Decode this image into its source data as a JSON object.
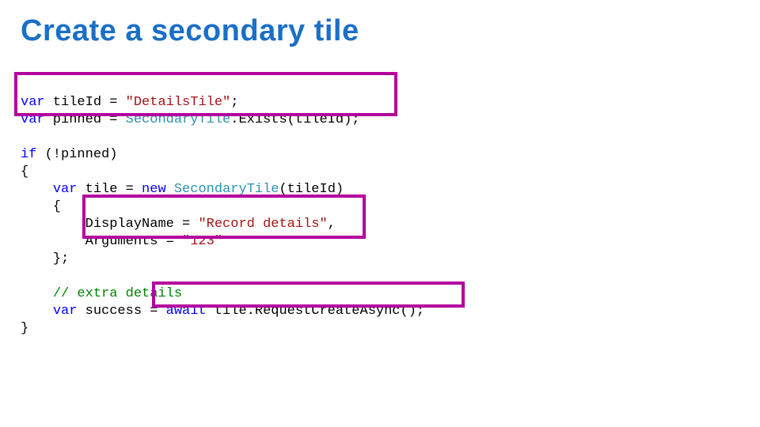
{
  "title": "Create a secondary tile",
  "code": {
    "l1": {
      "kw": "var",
      "rest": " tileId = ",
      "str": "\"DetailsTile\"",
      "semi": ";"
    },
    "l2": {
      "kw": "var",
      "rest": " pinned = ",
      "type": "SecondaryTile",
      "call": ".Exists(tileId);"
    },
    "l3": "",
    "l4": {
      "kw": "if",
      "rest": " (!pinned)"
    },
    "l5": "{",
    "l6": {
      "indent": "    ",
      "kw": "var",
      "rest1": " tile = ",
      "kw2": "new",
      "sp": " ",
      "type": "SecondaryTile",
      "rest2": "(tileId)"
    },
    "l7": "    {",
    "l8": {
      "indent": "        ",
      "name": "DisplayName = ",
      "str": "\"Record details\"",
      "comma": ","
    },
    "l9": {
      "indent": "        ",
      "name": "Arguments = ",
      "str": "\"123\""
    },
    "l10": "    };",
    "l11": "",
    "l12": {
      "indent": "    ",
      "com": "// extra details"
    },
    "l13": {
      "indent": "    ",
      "kw": "var",
      "rest1": " success = ",
      "kw2": "await",
      "rest2": " tile.RequestCreateAsync();"
    },
    "l14": "}"
  }
}
